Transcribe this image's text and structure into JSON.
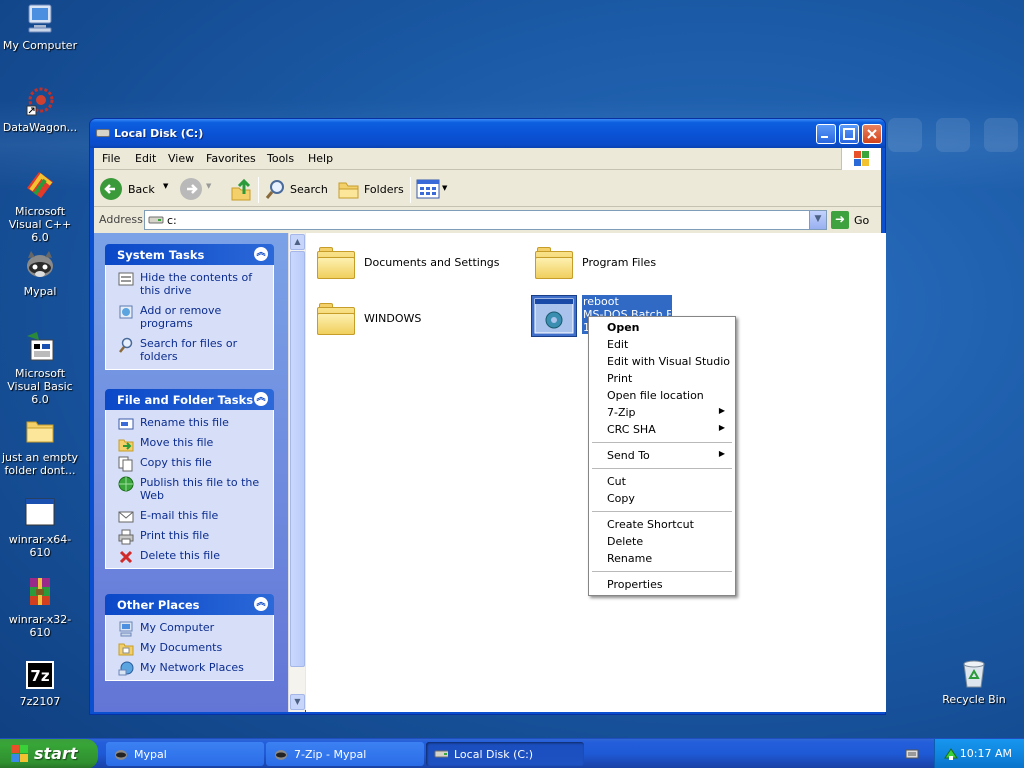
{
  "desktop": {
    "icons": [
      {
        "label": "My Computer"
      },
      {
        "label": "DataWagon..."
      },
      {
        "label": "Microsoft Visual C++ 6.0"
      },
      {
        "label": "Mypal"
      },
      {
        "label": "Microsoft Visual Basic 6.0"
      },
      {
        "label": "just an empty folder dont..."
      },
      {
        "label": "winrar-x64-610"
      },
      {
        "label": "winrar-x32-610"
      },
      {
        "label": "7z2107"
      },
      {
        "label": "Recycle Bin"
      }
    ]
  },
  "window": {
    "title": "Local Disk (C:)",
    "menu": [
      "File",
      "Edit",
      "View",
      "Favorites",
      "Tools",
      "Help"
    ],
    "toolbar": {
      "back": "Back",
      "search": "Search",
      "folders": "Folders"
    },
    "address": {
      "label": "Address",
      "value": "c:",
      "go": "Go"
    }
  },
  "tasks": {
    "system": {
      "title": "System Tasks",
      "items": [
        "Hide the contents of this drive",
        "Add or remove programs",
        "Search for files or folders"
      ]
    },
    "file": {
      "title": "File and Folder Tasks",
      "items": [
        "Rename this file",
        "Move this file",
        "Copy this file",
        "Publish this file to the Web",
        "E-mail this file",
        "Print this file",
        "Delete this file"
      ]
    },
    "other": {
      "title": "Other Places",
      "items": [
        "My Computer",
        "My Documents",
        "My Network Places"
      ]
    }
  },
  "files": [
    {
      "name": "Documents and Settings"
    },
    {
      "name": "Program Files"
    },
    {
      "name": "WINDOWS"
    },
    {
      "name": "reboot",
      "type": "MS-DOS Batch File",
      "size": "1"
    }
  ],
  "context_menu": {
    "items": [
      "Open",
      "Edit",
      "Edit with Visual Studio",
      "Print",
      "Open file location",
      "7-Zip",
      "CRC SHA",
      "Send To",
      "Cut",
      "Copy",
      "Create Shortcut",
      "Delete",
      "Rename",
      "Properties"
    ]
  },
  "taskbar": {
    "start": "start",
    "tasks": [
      "Mypal",
      "7-Zip - Mypal",
      "Local Disk (C:)"
    ],
    "clock": "10:17 AM"
  },
  "colors": {
    "selection": "#316ac5",
    "taskbar": "#245edb",
    "start": "#37a537"
  }
}
